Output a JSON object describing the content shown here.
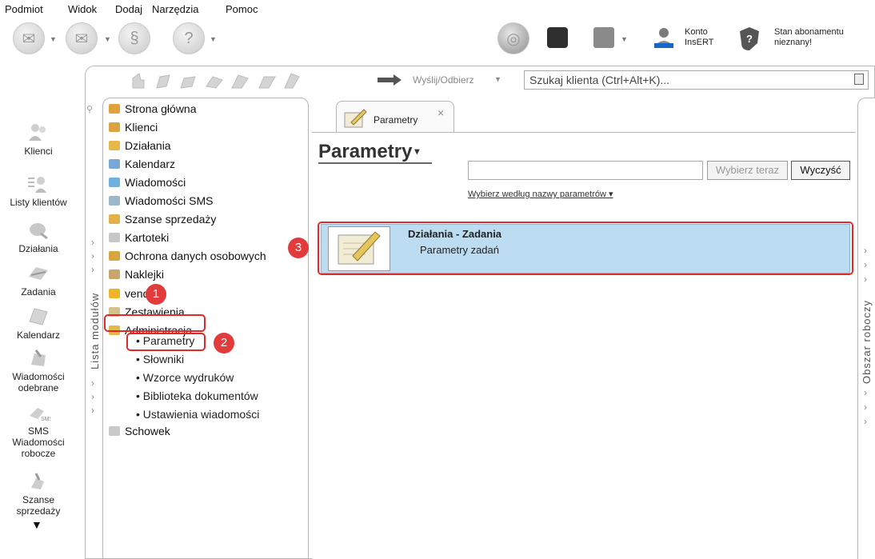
{
  "menu": {
    "items": [
      "Podmiot",
      "Widok",
      "Dodaj",
      "Narzędzia",
      "Pomoc"
    ]
  },
  "toolbar": {
    "account_line1": "Konto",
    "account_line2": "InsERT",
    "subscription_line1": "Stan abonamentu",
    "subscription_line2": "nieznany!"
  },
  "frame_toolbar": {
    "send_receive_label": "Wyślij/Odbierz",
    "search_placeholder": "Szukaj klienta (Ctrl+Alt+K)..."
  },
  "sidebar": {
    "items": [
      {
        "label": "Klienci",
        "icon": "clients-icon"
      },
      {
        "label": "Listy klientów",
        "icon": "client-lists-icon"
      },
      {
        "label": "Działania",
        "icon": "actions-icon"
      },
      {
        "label": "Zadania",
        "icon": "tasks-icon"
      },
      {
        "label": "Kalendarz",
        "icon": "calendar-icon"
      },
      {
        "label": "Wiadomości odebrane",
        "icon": "inbox-icon"
      },
      {
        "label": "SMS Wiadomości robocze",
        "icon": "sms-drafts-icon"
      },
      {
        "label": "Szanse sprzedaży",
        "icon": "sales-opportunities-icon"
      }
    ]
  },
  "module_panel": {
    "vertical_label": "Lista modułów",
    "items": [
      {
        "label": "Strona główna",
        "color": "#e0a23a"
      },
      {
        "label": "Klienci",
        "color": "#d9a441"
      },
      {
        "label": "Działania",
        "color": "#e6b848"
      },
      {
        "label": "Kalendarz",
        "color": "#7aa7d6"
      },
      {
        "label": "Wiadomości",
        "color": "#6fb2e0"
      },
      {
        "label": "Wiadomości SMS",
        "color": "#9bb7c9"
      },
      {
        "label": "Szanse sprzedaży",
        "color": "#e2b24a"
      },
      {
        "label": "Kartoteki",
        "color": "#c7c7c7"
      },
      {
        "label": "Ochrona danych osobowych",
        "color": "#d8a640"
      },
      {
        "label": "Naklejki",
        "color": "#c9a56b"
      },
      {
        "label": "vendero",
        "color": "#f0b429"
      },
      {
        "label": "Zestawienia",
        "color": "#d4c28a"
      },
      {
        "label": "Administracja",
        "color": "#e6b848"
      }
    ],
    "sub_items": [
      "Parametry",
      "Słowniki",
      "Wzorce wydruków",
      "Biblioteka dokumentów",
      "Ustawienia wiadomości"
    ],
    "last_item": "Schowek"
  },
  "tab": {
    "label": "Parametry",
    "close": "×"
  },
  "content": {
    "title": "Parametry",
    "choose_now_button": "Wybierz teraz",
    "clear_button": "Wyczyść",
    "filter_link": "Wybierz według nazwy parametrów",
    "result_title": "Działania - Zadania",
    "result_subtitle": "Parametry zadań"
  },
  "right_panel": {
    "vertical_label": "Obszar roboczy"
  },
  "annotations": {
    "badge1": "1",
    "badge2": "2",
    "badge3": "3"
  },
  "colors": {
    "highlight": "#e02a2a",
    "selection": "#bcdcf2",
    "badge": "#e23b3b"
  }
}
